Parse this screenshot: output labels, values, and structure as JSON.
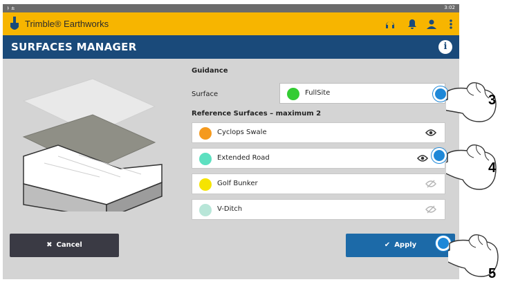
{
  "status_bar": {
    "left_icons": "ﾄ ±",
    "time": "3:02"
  },
  "app_bar": {
    "title": "Trimble® Earthworks",
    "logo_icon": "shovel-icon",
    "icons": [
      "headset-icon",
      "bell-icon",
      "user-icon",
      "more-vertical-icon"
    ]
  },
  "title_bar": {
    "title": "SURFACES MANAGER",
    "info_icon": "info-icon",
    "info_glyph": "i"
  },
  "guidance": {
    "title": "Guidance",
    "surface_label": "Surface",
    "surface_value": "FullSite",
    "surface_color": "#33cc33"
  },
  "reference": {
    "title": "Reference Surfaces – maximum 2",
    "items": [
      {
        "name": "Cyclops Swale",
        "color": "#f59a1e",
        "visible": true
      },
      {
        "name": "Extended Road",
        "color": "#5de0c0",
        "visible": true
      },
      {
        "name": "Golf Bunker",
        "color": "#f5e400",
        "visible": false
      },
      {
        "name": "V-Ditch",
        "color": "#b8e6d8",
        "visible": false
      }
    ]
  },
  "buttons": {
    "cancel": "Cancel",
    "cancel_icon": "✖",
    "apply": "Apply",
    "apply_icon": "✔"
  },
  "callouts": [
    "3",
    "4",
    "5"
  ]
}
